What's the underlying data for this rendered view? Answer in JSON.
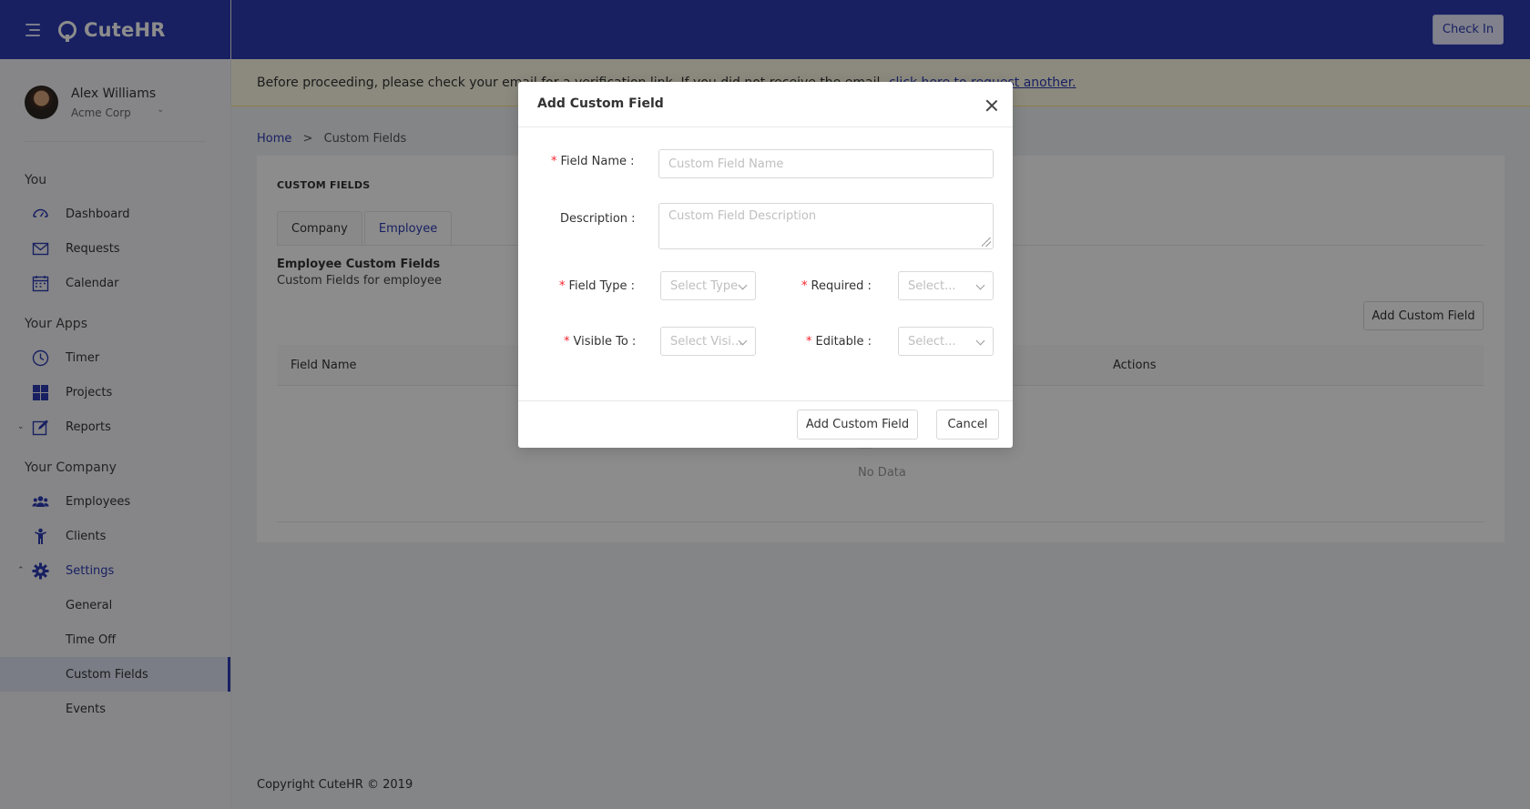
{
  "brand": {
    "name": "CuteHR"
  },
  "user": {
    "name": "Alex Williams",
    "company": "Acme Corp"
  },
  "sidebar": {
    "sections": [
      {
        "title": "You",
        "items": [
          "Dashboard",
          "Requests",
          "Calendar"
        ]
      },
      {
        "title": "Your Apps",
        "items": [
          "Timer",
          "Projects",
          "Reports"
        ]
      },
      {
        "title": "Your Company",
        "items": [
          "Employees",
          "Clients",
          "Settings"
        ]
      }
    ],
    "settings_sub": [
      "General",
      "Time Off",
      "Custom Fields",
      "Events"
    ]
  },
  "topbar": {
    "checkin_label": "Check In"
  },
  "notice": {
    "text": "Before proceeding, please check your email for a verification link. If you did not receive the email,",
    "link": "click here to request another."
  },
  "breadcrumb": {
    "home": "Home",
    "sep": ">",
    "current": "Custom Fields"
  },
  "card": {
    "title": "CUSTOM FIELDS",
    "tabs": [
      "Company",
      "Employee"
    ],
    "section_title": "Employee Custom Fields",
    "section_desc": "Custom Fields for employee",
    "add_button": "Add Custom Field",
    "columns": [
      "Field Name",
      "Actions"
    ],
    "empty_text": "No Data"
  },
  "footer": {
    "text": "Copyright CuteHR © 2019"
  },
  "modal": {
    "title": "Add Custom Field",
    "field_name_label": "Field Name :",
    "field_name_placeholder": "Custom Field Name",
    "description_label": "Description :",
    "description_placeholder": "Custom Field Description",
    "field_type_label": "Field Type :",
    "field_type_placeholder": "Select Type",
    "required_label": "Required :",
    "required_placeholder": "Select...",
    "visible_to_label": "Visible To :",
    "visible_to_placeholder": "Select Visi...",
    "editable_label": "Editable :",
    "editable_placeholder": "Select...",
    "required_mark": "*",
    "submit_label": "Add Custom Field",
    "cancel_label": "Cancel"
  },
  "colors": {
    "primary": "#2d3bb3",
    "danger": "#f5222d"
  }
}
